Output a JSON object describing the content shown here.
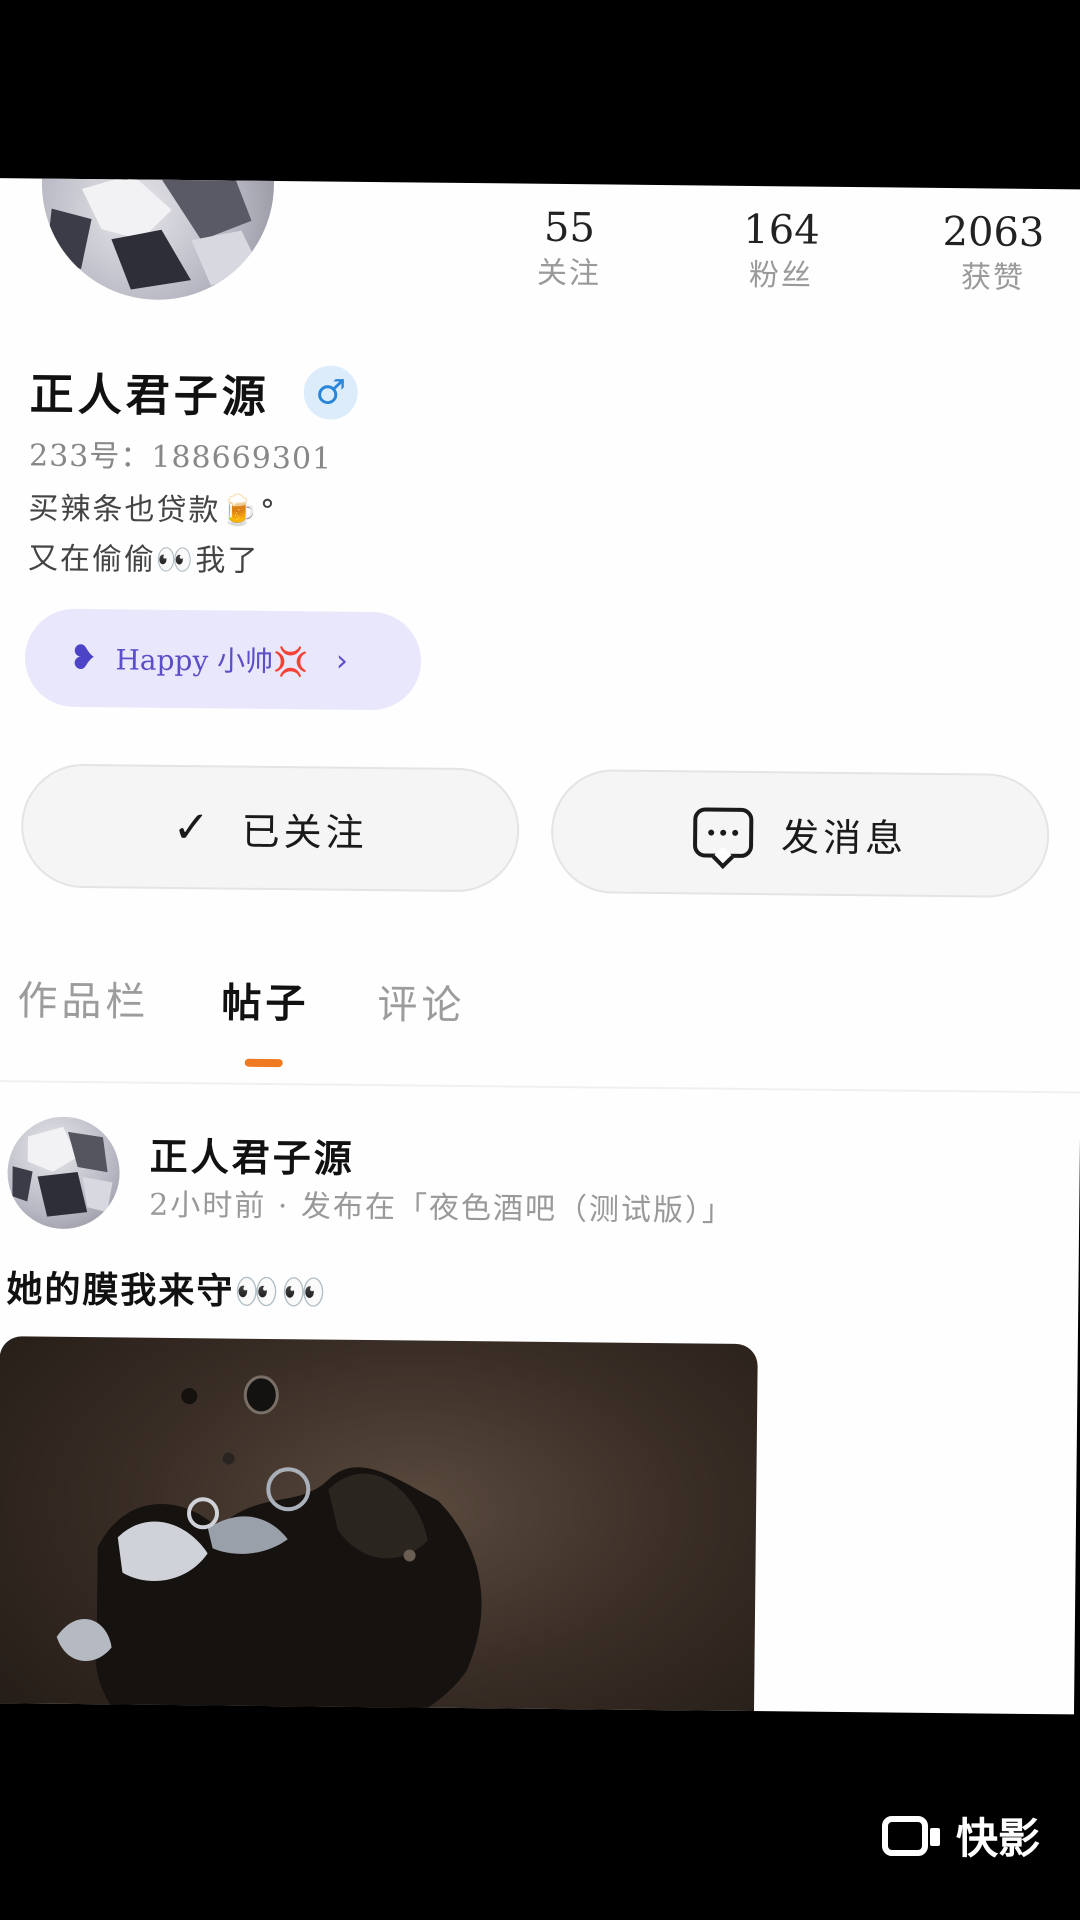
{
  "profile": {
    "name": "正人君子源",
    "gender_symbol": "♂",
    "uid": "233号：188669301",
    "bio_line1": "买辣条也贷款🍺°",
    "bio_line2": "又在偷偷👀我了",
    "tag_label": "Happy 小帅💢",
    "tag_icon": "heart-icon"
  },
  "stats": [
    {
      "value": "55",
      "label": "关注"
    },
    {
      "value": "164",
      "label": "粉丝"
    },
    {
      "value": "2063",
      "label": "获赞"
    }
  ],
  "actions": {
    "follow_label": "已关注",
    "message_label": "发消息"
  },
  "tabs": [
    {
      "label": "作品栏",
      "active": false
    },
    {
      "label": "帖子",
      "active": true
    },
    {
      "label": "评论",
      "active": false
    }
  ],
  "post": {
    "author": "正人君子源",
    "meta": "2小时前 · 发布在「夜色酒吧（测试版）」",
    "text": "她的膜我来守👀👀"
  },
  "watermark": {
    "label": "快影"
  },
  "colors": {
    "accent_orange": "#f07a22",
    "tag_bg": "#e9e7fb",
    "tag_text": "#5b4fc9",
    "gender_blue": "#2a86d8"
  }
}
